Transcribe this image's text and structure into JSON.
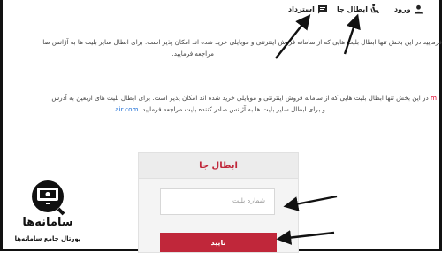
{
  "nav": {
    "login": "ورود",
    "cancel": "ابطال جا",
    "refund": "استرداد"
  },
  "paragraphs": {
    "p1_line1": "فرمایید در این بخش تنها ابطال بلیت هایی که از سامانه فروش اینترنتی و موبایلی خرید شده اند امکان پذیر است. برای ابطال سایر بلیت ها به آژانس صا",
    "p1_line2": "مراجعه فرمایید.",
    "p2_line1_a": "در این بخش تنها ابطال بلیت هایی که از سامانه فروش اینترنتی و موبایلی خرید شده اند امکان پذیر است. برای ابطال بلیت های اربعین به آدرس",
    "p2_line1_red": "m",
    "p2_line2_blue": "air.com",
    "p2_line2_b": "و برای ابطال سایر بلیت ها به آژانس صادر کننده بلیت مراجعه فرمایید."
  },
  "form": {
    "title": "ابطال جا",
    "ticket_placeholder": "شماره بلیت",
    "submit_label": "تایید"
  },
  "logo": {
    "name": "سامانه‌ها",
    "tagline": "پورتال جامع سامانه‌ها"
  },
  "colors": {
    "brand": "#c0273a",
    "arrow": "#111111"
  }
}
